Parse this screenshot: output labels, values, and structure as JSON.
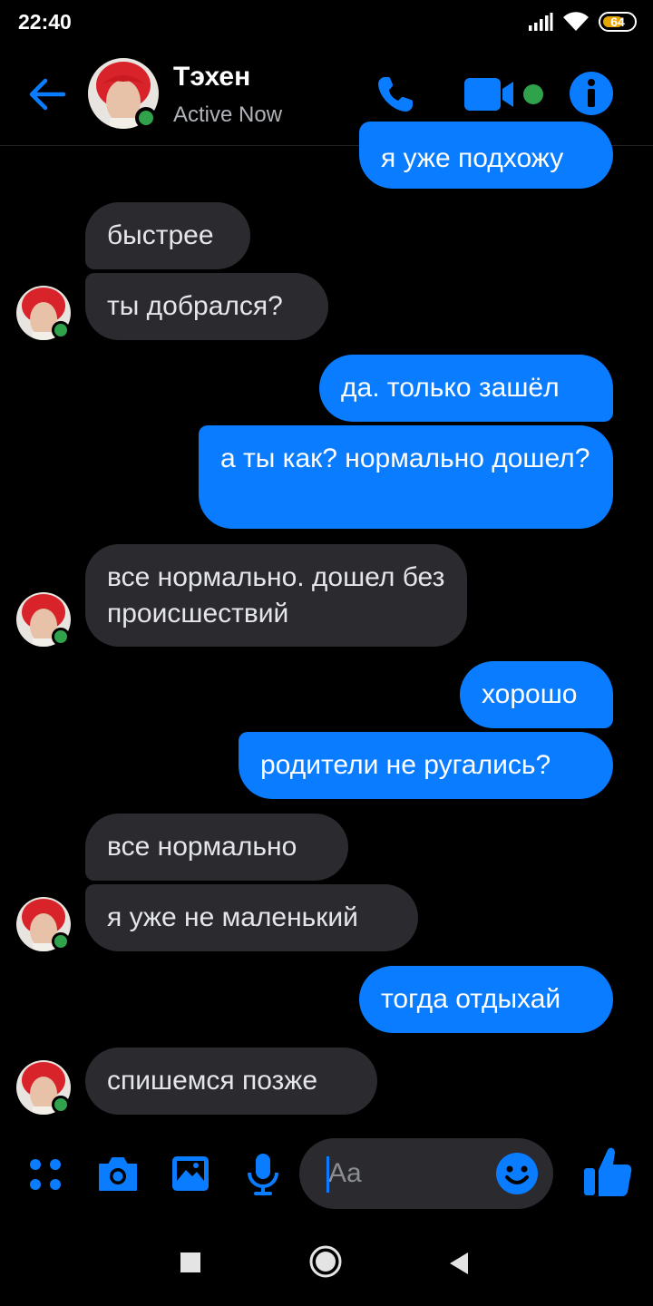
{
  "status_bar": {
    "time": "22:40",
    "battery": "64",
    "colors": {
      "battery_fill": "#e8a600"
    }
  },
  "header": {
    "contact_name": "Тэхен",
    "contact_status": "Active Now",
    "icons": [
      "back-arrow-icon",
      "phone-icon",
      "video-camera-icon",
      "info-icon"
    ]
  },
  "messages": [
    {
      "side": "out",
      "text": "я уже подхожу"
    },
    {
      "side": "in",
      "text": "быстрее"
    },
    {
      "side": "in",
      "text": "ты добрался?"
    },
    {
      "side": "out",
      "text": "да. только зашёл"
    },
    {
      "side": "out",
      "text": "а ты как? нормально дошел?"
    },
    {
      "side": "in",
      "text": "все нормально. дошел без происшествий"
    },
    {
      "side": "out",
      "text": "хорошо"
    },
    {
      "side": "out",
      "text": "родители не ругались?"
    },
    {
      "side": "in",
      "text": "все нормально"
    },
    {
      "side": "in",
      "text": "я уже не маленький"
    },
    {
      "side": "out",
      "text": "тогда отдыхай"
    },
    {
      "side": "in",
      "text": "спишемся позже"
    }
  ],
  "composer": {
    "placeholder": "Aa",
    "icons": [
      "menu-dots-icon",
      "camera-icon",
      "gallery-icon",
      "microphone-icon",
      "emoji-icon",
      "thumbs-up-icon"
    ]
  },
  "nav_bar": {
    "icons": [
      "recents-icon",
      "home-icon",
      "back-icon"
    ]
  },
  "colors": {
    "accent": "#0a7cff",
    "incoming_bubble": "#2b2b2f",
    "presence": "#31a24c",
    "background": "#000000"
  }
}
